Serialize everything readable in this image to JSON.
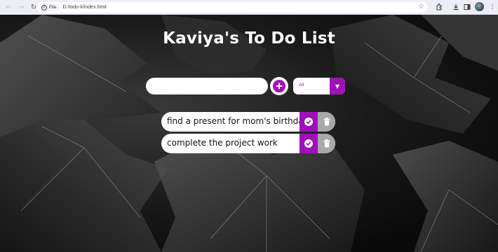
{
  "browser": {
    "file_chip_label": "File",
    "url": "D:/todo-k/index.html"
  },
  "page": {
    "title": "Kaviya's To Do List",
    "input_value": "",
    "filter": {
      "selected": "All"
    }
  },
  "todos": [
    {
      "text": "find a present for mom's birthday"
    },
    {
      "text": "complete the project work"
    }
  ],
  "colors": {
    "accent": "#a10fba",
    "trash": "#a8a8a8",
    "title": "#ffffff"
  },
  "icons": {
    "add": "plus-circle-icon",
    "complete": "check-circle-icon",
    "delete": "trash-icon",
    "dropdown": "caret-down-icon"
  }
}
